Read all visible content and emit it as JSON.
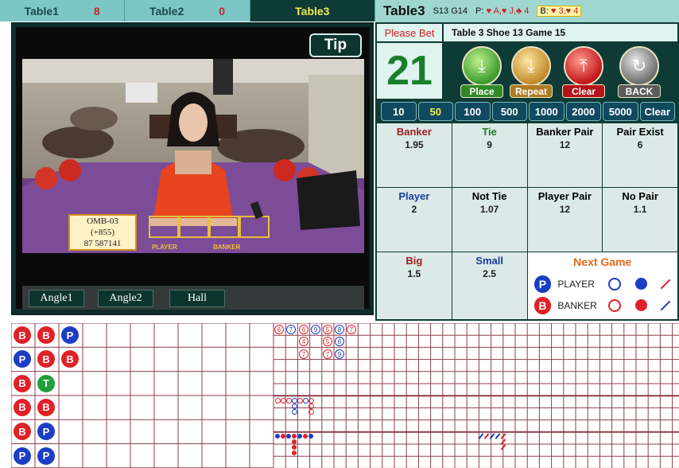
{
  "tabs": [
    {
      "name": "Table1",
      "count": "8",
      "active": false
    },
    {
      "name": "Table2",
      "count": "0",
      "active": false
    },
    {
      "name": "Table3",
      "count": "",
      "active": true
    }
  ],
  "video": {
    "tip_label": "Tip",
    "angles": [
      "Angle1",
      "Angle2",
      "Hall"
    ],
    "card_lines": [
      "OMB-03",
      "(+855)",
      "87 587141"
    ],
    "table_labels": [
      "PLAYER",
      "BANKER"
    ]
  },
  "header": {
    "table": "Table3",
    "sg": "S13 G14",
    "player_label": "P:",
    "player_cards": "♥ A,♥ J,♣ 4",
    "banker_label": "B:",
    "banker_cards": "♥ 3,♥ 4"
  },
  "status": {
    "please_bet": "Please Bet",
    "game_info": "Table 3  Shoe 13  Game 15",
    "countdown": "21"
  },
  "controls": [
    {
      "label": "Place",
      "icon": "place-icon",
      "color": "#3c9b2e"
    },
    {
      "label": "Repeat",
      "icon": "repeat-icon",
      "color": "#c28a2a"
    },
    {
      "label": "Clear",
      "icon": "clear-icon",
      "color": "#c3161c"
    },
    {
      "label": "BACK",
      "icon": "back-icon",
      "color": "#6e6e6e"
    }
  ],
  "chips": [
    "10",
    "50",
    "100",
    "500",
    "1000",
    "2000",
    "5000",
    "Clear"
  ],
  "selected_chip": "50",
  "bets": [
    {
      "name": "Banker",
      "odds": "1.95",
      "color": "#a01d22"
    },
    {
      "name": "Tie",
      "odds": "9",
      "color": "#1e7a2c"
    },
    {
      "name": "Banker Pair",
      "odds": "12",
      "color": "#101010"
    },
    {
      "name": "Pair Exist",
      "odds": "6",
      "color": "#101010"
    },
    {
      "name": "Player",
      "odds": "2",
      "color": "#1b3e9e"
    },
    {
      "name": "Not Tie",
      "odds": "1.07",
      "color": "#101010"
    },
    {
      "name": "Player Pair",
      "odds": "12",
      "color": "#101010"
    },
    {
      "name": "No Pair",
      "odds": "1.1",
      "color": "#101010"
    },
    {
      "name": "Big",
      "odds": "1.5",
      "color": "#a01d22"
    },
    {
      "name": "Small",
      "odds": "2.5",
      "color": "#1b3e9e"
    }
  ],
  "next_game": {
    "title": "Next Game",
    "player": {
      "badge": "P",
      "label": "PLAYER"
    },
    "banker": {
      "badge": "B",
      "label": "BANKER"
    }
  },
  "bead_road": [
    [
      "B",
      "B",
      "P"
    ],
    [
      "P",
      "B",
      "B"
    ],
    [
      "B",
      "T"
    ],
    [
      "B",
      "B"
    ],
    [
      "B",
      "P"
    ],
    [
      "P",
      "P"
    ]
  ],
  "colors": {
    "banker": "#e02128",
    "player": "#1b3ec5",
    "tie": "#1f9e3a",
    "grid_line": "#8f3e4c"
  }
}
